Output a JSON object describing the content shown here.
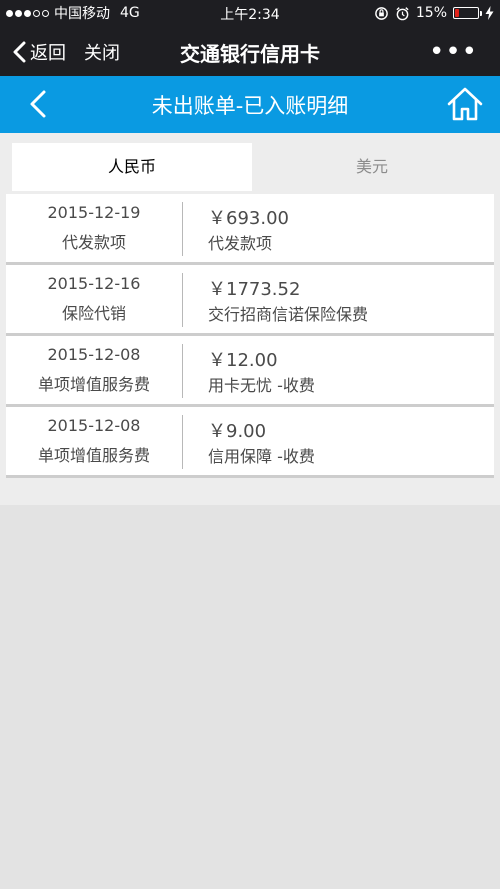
{
  "status_bar": {
    "carrier": "中国移动",
    "network": "4G",
    "time": "上午2:34",
    "battery_percent": "15%",
    "battery_level": 0.15,
    "colors": {
      "battery_low": "#e2231a"
    }
  },
  "nav": {
    "back_label": "返回",
    "close_label": "关闭",
    "title": "交通银行信用卡",
    "more_label": "•••"
  },
  "header": {
    "title": "未出账单-已入账明细",
    "color": "#0a9ae2"
  },
  "tabs": [
    {
      "label": "人民币",
      "active": true
    },
    {
      "label": "美元",
      "active": false
    }
  ],
  "transactions": [
    {
      "date": "2015-12-19",
      "category": "代发款项",
      "amount": "￥693.00",
      "description": "代发款项"
    },
    {
      "date": "2015-12-16",
      "category": "保险代销",
      "amount": "￥1773.52",
      "description": "交行招商信诺保险保费"
    },
    {
      "date": "2015-12-08",
      "category": "单项增值服务费",
      "amount": "￥12.00",
      "description": "用卡无忧 -收费"
    },
    {
      "date": "2015-12-08",
      "category": "单项增值服务费",
      "amount": "￥9.00",
      "description": "信用保障 -收费"
    }
  ]
}
